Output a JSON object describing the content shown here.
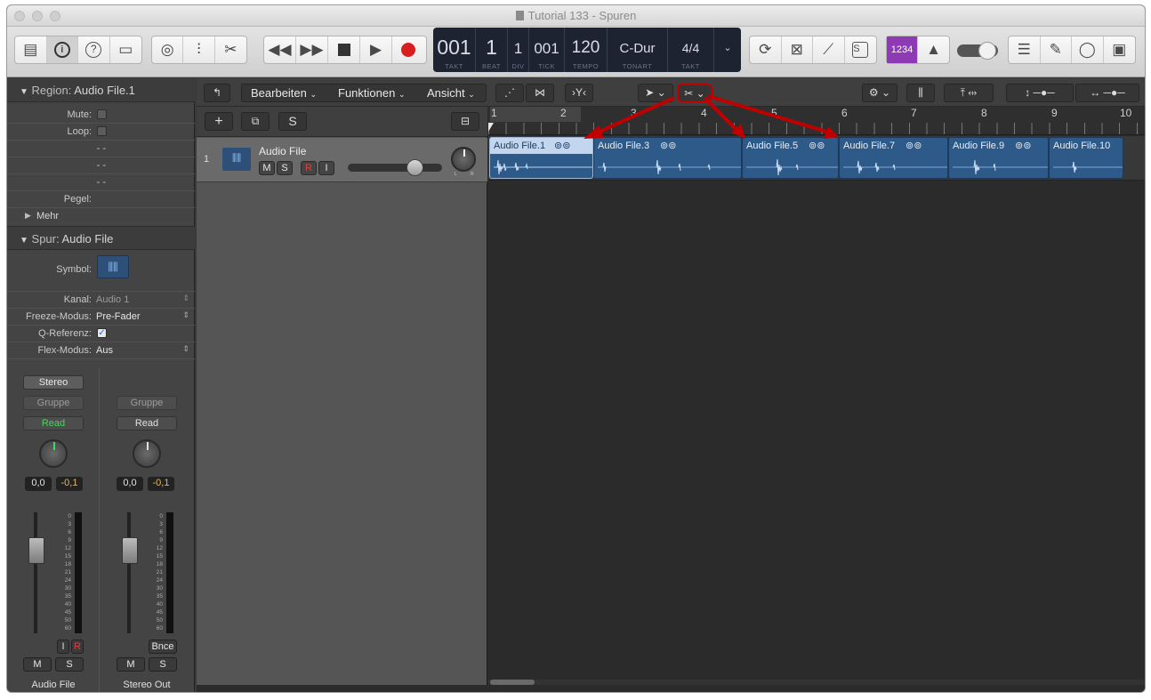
{
  "window": {
    "title": "Tutorial 133 - Spuren"
  },
  "lcd": {
    "takt": "001",
    "beat": "1",
    "div": "1",
    "tick": "001",
    "tempo": "120",
    "tonart": "C-Dur",
    "taktart": "4/4",
    "labels": {
      "takt": "TAKT",
      "beat": "BEAT",
      "div": "DIV",
      "tick": "TICK",
      "tempo": "TEMPO",
      "tonart": "TONART",
      "taktart": "TAKT"
    }
  },
  "toolbar": {
    "countin": "1234"
  },
  "inspector": {
    "region_header": "Region:",
    "region_name": "Audio File.1",
    "mute_label": "Mute:",
    "loop_label": "Loop:",
    "dash1": "- -",
    "dash2": "- -",
    "dash3": "- -",
    "pegel_label": "Pegel:",
    "mehr_label": "Mehr",
    "track_header": "Spur:",
    "track_name": "Audio File",
    "symbol_label": "Symbol:",
    "kanal_label": "Kanal:",
    "kanal_value": "Audio 1",
    "freeze_label": "Freeze-Modus:",
    "freeze_value": "Pre-Fader",
    "qref_label": "Q-Referenz:",
    "qref_value": "✓",
    "flex_label": "Flex-Modus:",
    "flex_value": "Aus"
  },
  "strips": [
    {
      "name": "Audio File",
      "format": "Stereo",
      "group": "Gruppe",
      "automation": "Read",
      "volume": "0,0",
      "peak": "-0,1",
      "input_btn": "I",
      "rec_btn": "R",
      "mute": "M",
      "solo": "S"
    },
    {
      "name": "Stereo Out",
      "group": "Gruppe",
      "automation": "Read",
      "volume": "0,0",
      "peak": "-0,1",
      "bounce": "Bnce",
      "mute": "M",
      "solo": "S"
    }
  ],
  "meter_scale": [
    "0",
    "3",
    "6",
    "9",
    "12",
    "15",
    "18",
    "21",
    "24",
    "30",
    "35",
    "40",
    "45",
    "50",
    "60"
  ],
  "local_menu": {
    "edit": "Bearbeiten",
    "functions": "Funktionen",
    "view": "Ansicht"
  },
  "track_list_bar": {
    "add": "+",
    "solo": "S"
  },
  "track": {
    "number": "1",
    "name": "Audio File",
    "mute": "M",
    "solo": "S",
    "rec": "R",
    "input": "I",
    "pan_l": "L",
    "pan_r": "R"
  },
  "ruler": [
    "1",
    "2",
    "3",
    "4",
    "5",
    "6",
    "7",
    "8",
    "9",
    "10"
  ],
  "regions": [
    {
      "name": "Audio File.1",
      "selected": true
    },
    {
      "name": "Audio File.3",
      "selected": false
    },
    {
      "name": "Audio File.5",
      "selected": false
    },
    {
      "name": "Audio File.7",
      "selected": false
    },
    {
      "name": "Audio File.9",
      "selected": false
    },
    {
      "name": "Audio File.10",
      "selected": false
    }
  ],
  "colors": {
    "region": "#2e5a8a",
    "region_selected": "#c2d6ee",
    "highlight": "#c00000",
    "countin": "#8e3ab5",
    "read_text": "#3ddc5a"
  }
}
